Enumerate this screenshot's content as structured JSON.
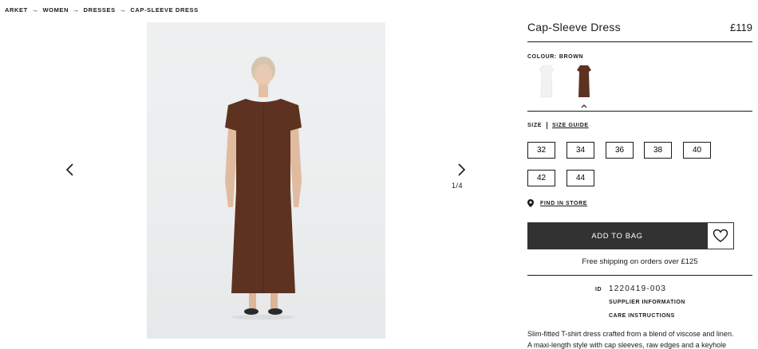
{
  "breadcrumb": {
    "items": [
      "ARKET",
      "WOMEN",
      "DRESSES",
      "CAP-SLEEVE DRESS"
    ],
    "separator_icon": "arrow-right-icon"
  },
  "gallery": {
    "counter": "1/4",
    "prev_icon": "chevron-left-icon",
    "next_icon": "chevron-right-icon"
  },
  "product": {
    "title": "Cap-Sleeve Dress",
    "price": "£119",
    "colour_label": "COLOUR:",
    "colour_value": "BROWN",
    "swatches": [
      "White",
      "Brown"
    ],
    "selected_swatch": "Brown",
    "size_label": "SIZE",
    "size_guide": "SIZE GUIDE",
    "sizes": [
      "32",
      "34",
      "36",
      "38",
      "40",
      "42",
      "44"
    ],
    "find_in_store": "FIND IN STORE",
    "add_to_bag": "ADD TO BAG",
    "shipping_note": "Free shipping on orders over £125",
    "id_label": "ID",
    "id_value": "1220419-003",
    "supplier_info": "SUPPLIER INFORMATION",
    "care_instructions": "CARE INSTRUCTIONS",
    "description_line1": "Slim-fitted T-shirt dress crafted from a blend of viscose and linen.",
    "description_line2": "A maxi-length style with cap sleeves, raw edges and a keyhole"
  },
  "colors": {
    "button_dark": "#323232",
    "dress_brown": "#5e3220",
    "text": "#1a1a1a"
  }
}
